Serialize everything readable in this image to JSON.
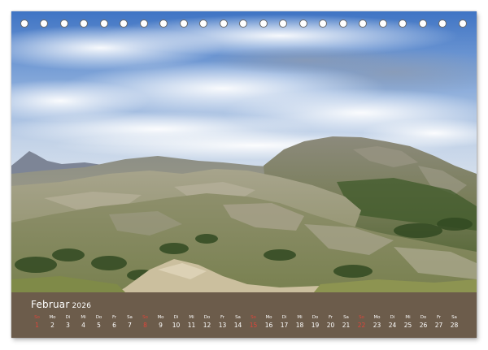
{
  "calendar": {
    "month": "Februar",
    "year": "2026",
    "days": [
      {
        "wd": "So",
        "dn": "1",
        "sun": true
      },
      {
        "wd": "Mo",
        "dn": "2"
      },
      {
        "wd": "Di",
        "dn": "3"
      },
      {
        "wd": "Mi",
        "dn": "4"
      },
      {
        "wd": "Do",
        "dn": "5"
      },
      {
        "wd": "Fr",
        "dn": "6"
      },
      {
        "wd": "Sa",
        "dn": "7"
      },
      {
        "wd": "So",
        "dn": "8",
        "sun": true
      },
      {
        "wd": "Mo",
        "dn": "9"
      },
      {
        "wd": "Di",
        "dn": "10"
      },
      {
        "wd": "Mi",
        "dn": "11"
      },
      {
        "wd": "Do",
        "dn": "12"
      },
      {
        "wd": "Fr",
        "dn": "13"
      },
      {
        "wd": "Sa",
        "dn": "14"
      },
      {
        "wd": "So",
        "dn": "15",
        "sun": true
      },
      {
        "wd": "Mo",
        "dn": "16"
      },
      {
        "wd": "Di",
        "dn": "17"
      },
      {
        "wd": "Mi",
        "dn": "18"
      },
      {
        "wd": "Do",
        "dn": "19"
      },
      {
        "wd": "Fr",
        "dn": "20"
      },
      {
        "wd": "Sa",
        "dn": "21"
      },
      {
        "wd": "So",
        "dn": "22",
        "sun": true
      },
      {
        "wd": "Mo",
        "dn": "23"
      },
      {
        "wd": "Di",
        "dn": "24"
      },
      {
        "wd": "Mi",
        "dn": "25"
      },
      {
        "wd": "Do",
        "dn": "26"
      },
      {
        "wd": "Fr",
        "dn": "27"
      },
      {
        "wd": "Sa",
        "dn": "28"
      }
    ]
  },
  "colors": {
    "sunday": "#e0453a",
    "band": "#5f5041"
  }
}
